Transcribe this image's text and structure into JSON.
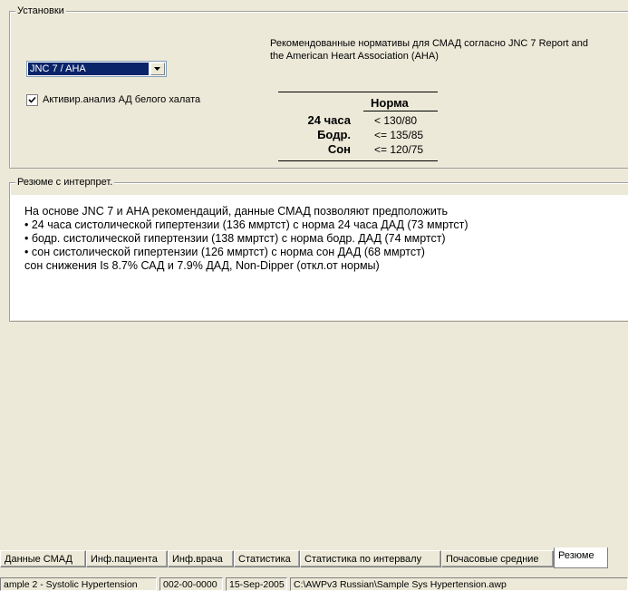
{
  "settings": {
    "legend": "Установки",
    "standard_select": {
      "value": "JNC 7 / AHA"
    },
    "white_coat_checkbox": {
      "checked": true,
      "label": "Активир.анализ АД белого халата"
    },
    "recommendation_text": "Рекомендованные нормативы для СМАД согласно JNC 7 Report and the American Heart Association (AHA)",
    "norms_table": {
      "title": "Норма",
      "rows": [
        {
          "label": "24 часа",
          "value": "< 130/80"
        },
        {
          "label": "Бодр.",
          "value": "<= 135/85"
        },
        {
          "label": "Сон",
          "value": "<= 120/75"
        }
      ]
    }
  },
  "summary": {
    "legend": "Резюме с интерпрет.",
    "lines": [
      "На основе JNC 7 и AHA рекомендаций, данные СМАД позволяют предположить",
      "• 24 часа систолической гипертензии (136 ммртст) с норма 24 часа ДАД (73 ммртст)",
      "• бодр. систолической гипертензии (138 ммртст) с норма бодр. ДАД (74 ммртст)",
      "• сон систолической гипертензии (126 ммртст) с норма сон ДАД (68 ммртст)",
      "сон снижения Is 8.7% САД и 7.9% ДАД, Non-Dipper (откл.от нормы)"
    ]
  },
  "tabs": [
    {
      "label": "Данные СМАД"
    },
    {
      "label": "Инф.пациента"
    },
    {
      "label": "Инф.врача"
    },
    {
      "label": "Статистика"
    },
    {
      "label": "Статистика по интервалу"
    },
    {
      "label": "Почасовые средние"
    },
    {
      "label": "Резюме",
      "active": true
    }
  ],
  "statusbar": [
    {
      "text": "ample 2 - Systolic Hypertension"
    },
    {
      "text": "002-00-0000"
    },
    {
      "text": "15-Sep-2005"
    },
    {
      "text": "C:\\AWPv3 Russian\\Sample Sys Hypertension.awp"
    }
  ],
  "colors": {
    "window_bg": "#ece9d8",
    "selection": "#0a246a",
    "panel_bg": "#ffffff"
  }
}
